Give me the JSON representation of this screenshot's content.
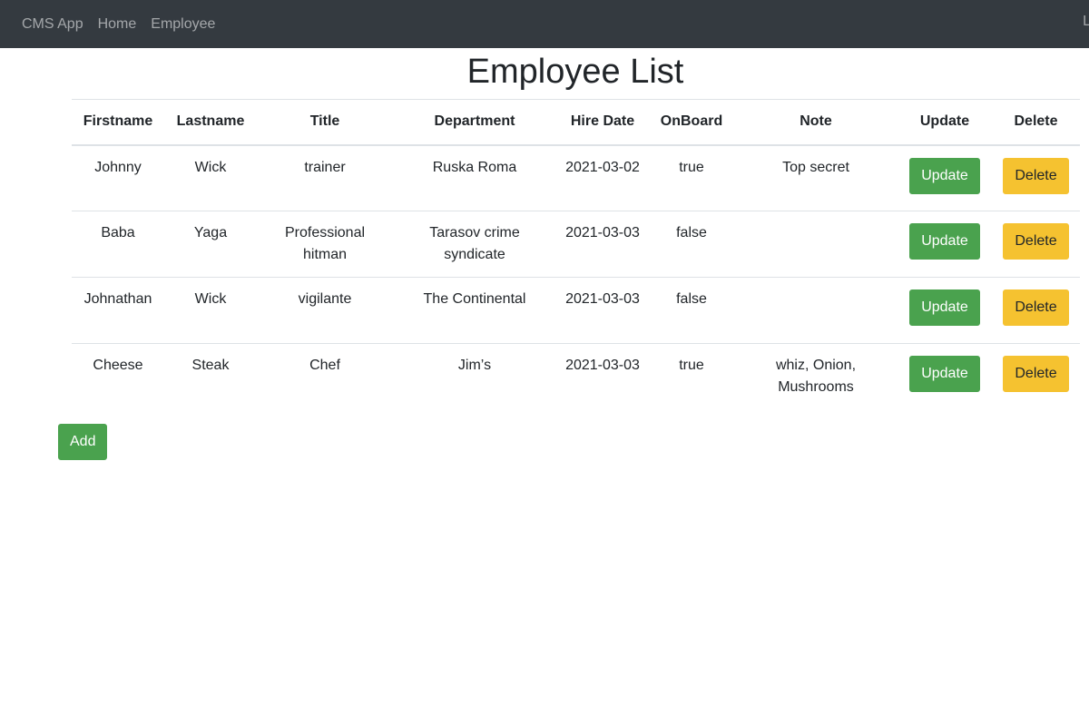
{
  "navbar": {
    "brand": "CMS App",
    "links": [
      "Home",
      "Employee"
    ],
    "right_text": "L"
  },
  "page": {
    "title": "Employee List"
  },
  "table": {
    "headers": [
      "Firstname",
      "Lastname",
      "Title",
      "Department",
      "Hire Date",
      "OnBoard",
      "Note",
      "Update",
      "Delete"
    ],
    "rows": [
      {
        "firstname": "Johnny",
        "lastname": "Wick",
        "title": "trainer",
        "department": "Ruska Roma",
        "hire_date": "2021-03-02",
        "onboard": "true",
        "note": "Top secret"
      },
      {
        "firstname": "Baba",
        "lastname": "Yaga",
        "title": "Professional hitman",
        "department": "Tarasov crime syndicate",
        "hire_date": "2021-03-03",
        "onboard": "false",
        "note": ""
      },
      {
        "firstname": "Johnathan",
        "lastname": "Wick",
        "title": "vigilante",
        "department": "The Continental",
        "hire_date": "2021-03-03",
        "onboard": "false",
        "note": ""
      },
      {
        "firstname": "Cheese",
        "lastname": "Steak",
        "title": "Chef",
        "department": "Jim’s",
        "hire_date": "2021-03-03",
        "onboard": "true",
        "note": "whiz, Onion, Mushrooms"
      }
    ],
    "update_label": "Update",
    "delete_label": "Delete"
  },
  "actions": {
    "add_label": "Add"
  },
  "colors": {
    "navbar_bg": "#343a40",
    "success": "#4aa24e",
    "warning": "#f5c230"
  }
}
